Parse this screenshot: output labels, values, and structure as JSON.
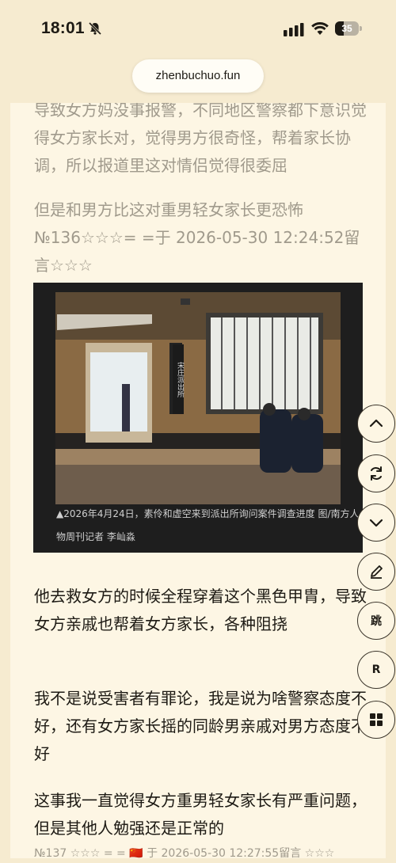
{
  "status_bar": {
    "time": "18:01",
    "battery_percent": 35,
    "battery_label": "35"
  },
  "browser": {
    "url": "zhenbuchuo.fun"
  },
  "article": {
    "para_top": "导致女方妈没事报警，不同地区警察都下意识觉得女方家长对，觉得男方很奇怪，帮着家长协调，所以报道里这对情侣觉得很委屈",
    "comment_136": "但是和男方比这对重男轻女家长更恐怖 №136☆☆☆= =于 2026-05-30 12:24:52留言☆☆☆",
    "photo_sign": "宋庄派出所",
    "photo_caption": "▲2026年4月24日，素伶和虚空来到派出所询问案件调查进度 图/南方人物周刊记者 李屾淼",
    "para_1": "他去救女方的时候全程穿着这个黑色甲胄，导致女方亲戚也帮着女方家长，各种阻挠",
    "para_2": "我不是说受害者有罪论，我是说为啥警察态度不好，还有女方家长摇的同龄男亲戚对男方态度不好",
    "para_3": "这事我一直觉得女方重男轻女家长有严重问题，但是其他人勉强还是正常的",
    "comment_137": "№137 ☆☆☆ = = 🇨🇳 于 2026-05-30 12:27:55留言 ☆☆☆"
  },
  "floating_buttons": {
    "jump_label": "跳",
    "reply_label": "R"
  },
  "icons": [
    "bell-slash-icon",
    "signal-icon",
    "wifi-icon",
    "battery-icon",
    "chevron-up-icon",
    "refresh-icon",
    "chevron-down-icon",
    "pencil-icon",
    "grid-icon"
  ]
}
